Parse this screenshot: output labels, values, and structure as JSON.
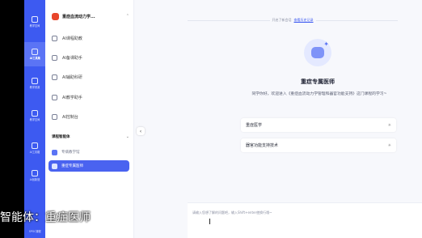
{
  "rail": {
    "items": [
      {
        "label": "教学空间"
      },
      {
        "label": "AI工具集"
      },
      {
        "label": "教学资源"
      },
      {
        "label": "教学空间"
      },
      {
        "label": "AI工具箱"
      },
      {
        "label": "AI创新馆"
      },
      {
        "label": "SPOC课程"
      }
    ]
  },
  "course": {
    "name": "重症血流动力学...",
    "chevron": "⌃"
  },
  "menu": [
    {
      "label": "AI课程助教"
    },
    {
      "label": "AI备课助手"
    },
    {
      "label": "AI辅助科研"
    },
    {
      "label": "AI教学助手"
    },
    {
      "label": "AI控制台"
    }
  ],
  "section": {
    "title": "课程智能体",
    "chevron": "⌄"
  },
  "agents": [
    {
      "label": "专病教学馆"
    },
    {
      "label": "重症专属医师"
    }
  ],
  "collapse": {
    "glyph": "‹"
  },
  "topbar": {
    "text": "开启了新会话",
    "link": "查看历史记录"
  },
  "hero": {
    "title": "重症专属医师",
    "greeting": "同学你好，欢迎进入《重症血流动力学管理和器官功能支持》这门课程的学习~"
  },
  "suggestions": [
    {
      "label": "重症医学"
    },
    {
      "label": "器官功能支持技术"
    }
  ],
  "input": {
    "placeholder": "请输入您想了解的问题吧，输入Shift+enter使换行哦~"
  },
  "caption": "智能体：重症医师"
}
